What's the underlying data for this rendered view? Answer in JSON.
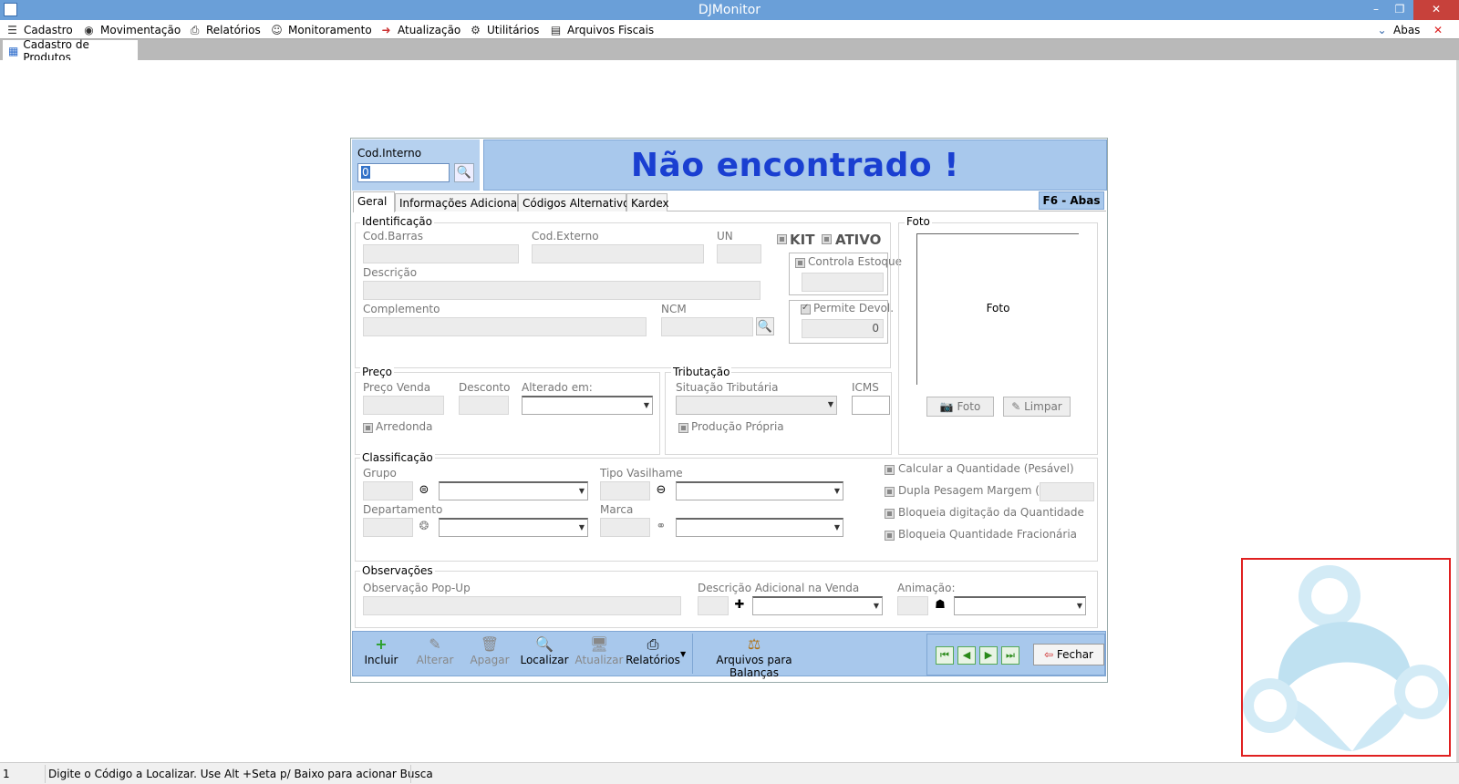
{
  "window": {
    "title": "DJMonitor"
  },
  "menu": {
    "items": [
      "Cadastro",
      "Movimentação",
      "Relatórios",
      "Monitoramento",
      "Atualização",
      "Utilitários",
      "Arquivos Fiscais"
    ],
    "abas_label": "Abas"
  },
  "doc_tab": {
    "label": "Cadastro de Produtos"
  },
  "form": {
    "cod_interno": {
      "label": "Cod.Interno",
      "value": "0"
    },
    "banner": "Não encontrado !",
    "tabs": [
      "Geral",
      "Informações Adicionais",
      "Códigos Alternativos",
      "Kardex"
    ],
    "f6_label": "F6 - Abas",
    "identificacao": {
      "title": "Identificação",
      "cod_barras": "Cod.Barras",
      "cod_externo": "Cod.Externo",
      "un": "UN",
      "kit": "KIT",
      "ativo": "ATIVO",
      "descricao": "Descrição",
      "complemento": "Complemento",
      "ncm": "NCM",
      "controla_estoque": "Controla Estoque",
      "permite_devol": "Permite Devol.",
      "permite_devol_value": "0"
    },
    "foto": {
      "title": "Foto",
      "placeholder": "Foto",
      "btn_foto": "Foto",
      "btn_limpar": "Limpar"
    },
    "preco": {
      "title": "Preço",
      "preco_venda": "Preço Venda",
      "desconto": "Desconto",
      "alterado_em": "Alterado em:",
      "arredonda": "Arredonda"
    },
    "tributacao": {
      "title": "Tributação",
      "situacao": "Situação Tributária",
      "icms": "ICMS",
      "producao_propria": "Produção Própria"
    },
    "classificacao": {
      "title": "Classificação",
      "grupo": "Grupo",
      "tipo_vasilhame": "Tipo Vasilhame",
      "departamento": "Departamento",
      "marca": "Marca",
      "calcular_qtd": "Calcular a Quantidade (Pesável)",
      "dupla_pesagem": "Dupla Pesagem Margem (%):",
      "bloqueia_digitacao": "Bloqueia digitação da Quantidade",
      "bloqueia_fracionaria": "Bloqueia Quantidade Fracionária"
    },
    "observacoes": {
      "title": "Observações",
      "popup": "Observação Pop-Up",
      "desc_adicional": "Descrição Adicional na Venda",
      "animacao": "Animação:"
    },
    "toolbar": {
      "incluir": "Incluir",
      "alterar": "Alterar",
      "apagar": "Apagar",
      "localizar": "Localizar",
      "atualizar": "Atualizar",
      "relatorios": "Relatórios",
      "arquivos_balancas": "Arquivos para Balanças",
      "fechar": "Fechar"
    }
  },
  "status": {
    "left": "1",
    "message": "Digite o Código a Localizar. Use Alt +Seta p/ Baixo para acionar Busca"
  }
}
